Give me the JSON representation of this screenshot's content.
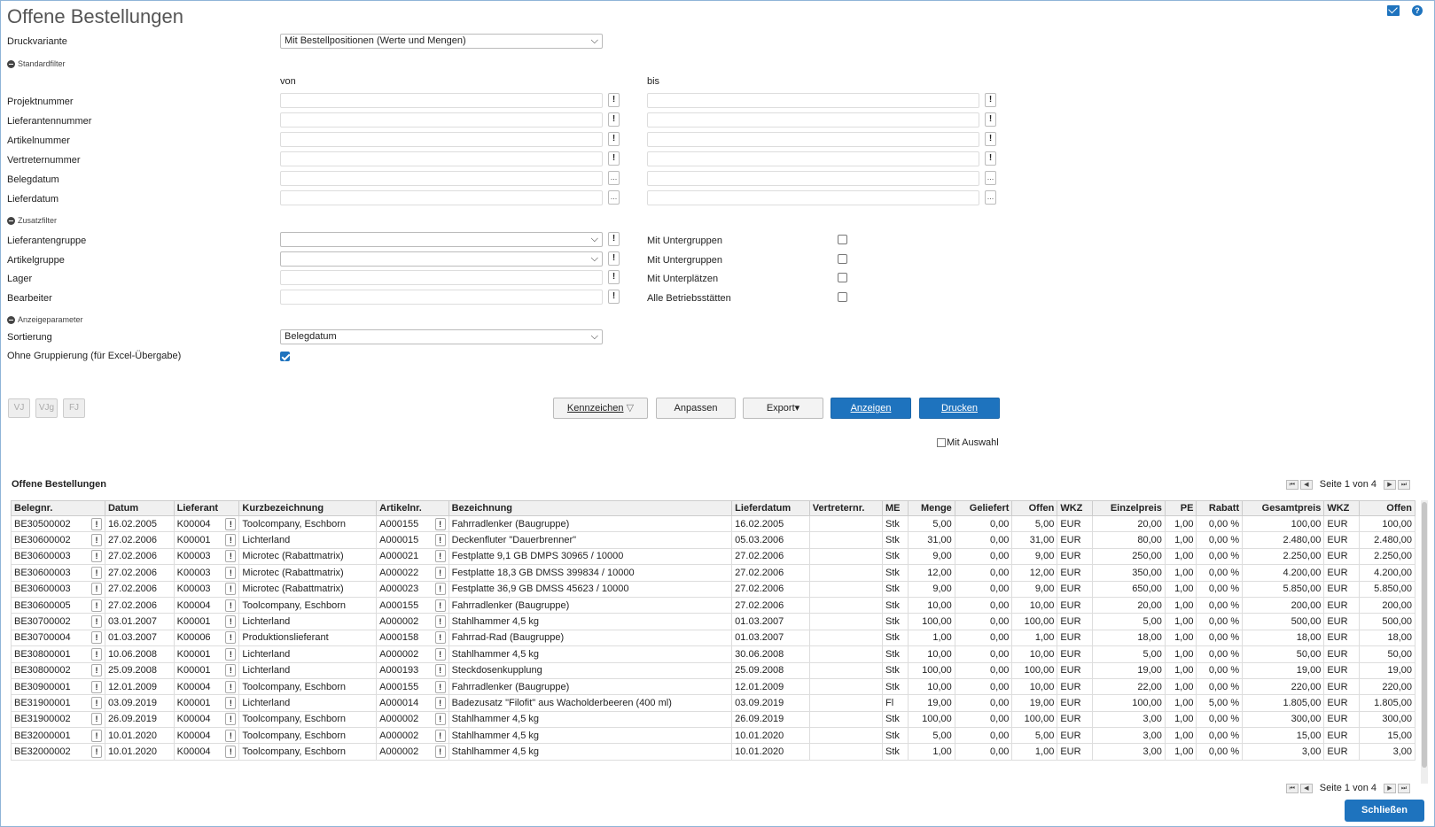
{
  "title": "Offene Bestellungen",
  "icons": {
    "mail": "mail-icon",
    "help": "help-icon"
  },
  "druckvariante": {
    "label": "Druckvariante",
    "value": "Mit Bestellpositionen (Werte und Mengen)"
  },
  "standardfilter": {
    "title": "Standardfilter",
    "von": "von",
    "bis": "bis",
    "rows": [
      "Projektnummer",
      "Lieferantennummer",
      "Artikelnummer",
      "Vertreternummer",
      "Belegdatum",
      "Lieferdatum"
    ]
  },
  "zusatzfilter": {
    "title": "Zusatzfilter",
    "rows": [
      {
        "label": "Lieferantengruppe",
        "right_label": "Mit Untergruppen"
      },
      {
        "label": "Artikelgruppe",
        "right_label": "Mit Untergruppen"
      },
      {
        "label": "Lager",
        "right_label": "Mit Unterplätzen"
      },
      {
        "label": "Bearbeiter",
        "right_label": "Alle Betriebsstätten"
      }
    ]
  },
  "anzeigeparameter": {
    "title": "Anzeigeparameter",
    "sortierung_label": "Sortierung",
    "sortierung_value": "Belegdatum",
    "gruppierung_label": "Ohne Gruppierung (für Excel-Übergabe)",
    "gruppierung_checked": true
  },
  "small_buttons": [
    "VJ",
    "VJg",
    "FJ"
  ],
  "buttons": {
    "kennzeichen": "Kennzeichen",
    "anpassen": "Anpassen",
    "export": "Export",
    "anzeigen": "Anzeigen",
    "drucken": "Drucken"
  },
  "mit_auswahl": "Mit Auswahl",
  "grid": {
    "title": "Offene Bestellungen",
    "pager": "Seite 1 von 4",
    "columns": [
      "Belegnr.",
      "Datum",
      "Lieferant",
      "Kurzbezeichnung",
      "Artikelnr.",
      "Bezeichnung",
      "Lieferdatum",
      "Vertreternr.",
      "ME",
      "Menge",
      "Geliefert",
      "Offen",
      "WKZ",
      "Einzelpreis",
      "PE",
      "Rabatt",
      "Gesamtpreis",
      "WKZ",
      "Offen"
    ],
    "rows": [
      [
        "BE30500002",
        "16.02.2005",
        "K00004",
        "Toolcompany, Eschborn",
        "A000155",
        "Fahrradlenker (Baugruppe)",
        "16.02.2005",
        "",
        "Stk",
        "5,00",
        "0,00",
        "5,00",
        "EUR",
        "20,00",
        "1,00",
        "0,00 %",
        "100,00",
        "EUR",
        "100,00"
      ],
      [
        "BE30600002",
        "27.02.2006",
        "K00001",
        "Lichterland",
        "A000015",
        "Deckenfluter \"Dauerbrenner\"",
        "05.03.2006",
        "",
        "Stk",
        "31,00",
        "0,00",
        "31,00",
        "EUR",
        "80,00",
        "1,00",
        "0,00 %",
        "2.480,00",
        "EUR",
        "2.480,00"
      ],
      [
        "BE30600003",
        "27.02.2006",
        "K00003",
        "Microtec (Rabattmatrix)",
        "A000021",
        "Festplatte 9,1 GB DMPS 30965 / 10000",
        "27.02.2006",
        "",
        "Stk",
        "9,00",
        "0,00",
        "9,00",
        "EUR",
        "250,00",
        "1,00",
        "0,00 %",
        "2.250,00",
        "EUR",
        "2.250,00"
      ],
      [
        "BE30600003",
        "27.02.2006",
        "K00003",
        "Microtec (Rabattmatrix)",
        "A000022",
        "Festplatte 18,3 GB DMSS 399834 / 10000",
        "27.02.2006",
        "",
        "Stk",
        "12,00",
        "0,00",
        "12,00",
        "EUR",
        "350,00",
        "1,00",
        "0,00 %",
        "4.200,00",
        "EUR",
        "4.200,00"
      ],
      [
        "BE30600003",
        "27.02.2006",
        "K00003",
        "Microtec (Rabattmatrix)",
        "A000023",
        "Festplatte 36,9 GB DMSS 45623 / 10000",
        "27.02.2006",
        "",
        "Stk",
        "9,00",
        "0,00",
        "9,00",
        "EUR",
        "650,00",
        "1,00",
        "0,00 %",
        "5.850,00",
        "EUR",
        "5.850,00"
      ],
      [
        "BE30600005",
        "27.02.2006",
        "K00004",
        "Toolcompany, Eschborn",
        "A000155",
        "Fahrradlenker (Baugruppe)",
        "27.02.2006",
        "",
        "Stk",
        "10,00",
        "0,00",
        "10,00",
        "EUR",
        "20,00",
        "1,00",
        "0,00 %",
        "200,00",
        "EUR",
        "200,00"
      ],
      [
        "BE30700002",
        "03.01.2007",
        "K00001",
        "Lichterland",
        "A000002",
        "Stahlhammer 4,5 kg",
        "01.03.2007",
        "",
        "Stk",
        "100,00",
        "0,00",
        "100,00",
        "EUR",
        "5,00",
        "1,00",
        "0,00 %",
        "500,00",
        "EUR",
        "500,00"
      ],
      [
        "BE30700004",
        "01.03.2007",
        "K00006",
        "Produktionslieferant",
        "A000158",
        "Fahrrad-Rad (Baugruppe)",
        "01.03.2007",
        "",
        "Stk",
        "1,00",
        "0,00",
        "1,00",
        "EUR",
        "18,00",
        "1,00",
        "0,00 %",
        "18,00",
        "EUR",
        "18,00"
      ],
      [
        "BE30800001",
        "10.06.2008",
        "K00001",
        "Lichterland",
        "A000002",
        "Stahlhammer 4,5 kg",
        "30.06.2008",
        "",
        "Stk",
        "10,00",
        "0,00",
        "10,00",
        "EUR",
        "5,00",
        "1,00",
        "0,00 %",
        "50,00",
        "EUR",
        "50,00"
      ],
      [
        "BE30800002",
        "25.09.2008",
        "K00001",
        "Lichterland",
        "A000193",
        "Steckdosenkupplung",
        "25.09.2008",
        "",
        "Stk",
        "100,00",
        "0,00",
        "100,00",
        "EUR",
        "19,00",
        "1,00",
        "0,00 %",
        "19,00",
        "EUR",
        "19,00"
      ],
      [
        "BE30900001",
        "12.01.2009",
        "K00004",
        "Toolcompany, Eschborn",
        "A000155",
        "Fahrradlenker (Baugruppe)",
        "12.01.2009",
        "",
        "Stk",
        "10,00",
        "0,00",
        "10,00",
        "EUR",
        "22,00",
        "1,00",
        "0,00 %",
        "220,00",
        "EUR",
        "220,00"
      ],
      [
        "BE31900001",
        "03.09.2019",
        "K00001",
        "Lichterland",
        "A000014",
        "Badezusatz \"Filofit\" aus Wacholderbeeren (400 ml)",
        "03.09.2019",
        "",
        "Fl",
        "19,00",
        "0,00",
        "19,00",
        "EUR",
        "100,00",
        "1,00",
        "5,00 %",
        "1.805,00",
        "EUR",
        "1.805,00"
      ],
      [
        "BE31900002",
        "26.09.2019",
        "K00004",
        "Toolcompany, Eschborn",
        "A000002",
        "Stahlhammer 4,5 kg",
        "26.09.2019",
        "",
        "Stk",
        "100,00",
        "0,00",
        "100,00",
        "EUR",
        "3,00",
        "1,00",
        "0,00 %",
        "300,00",
        "EUR",
        "300,00"
      ],
      [
        "BE32000001",
        "10.01.2020",
        "K00004",
        "Toolcompany, Eschborn",
        "A000002",
        "Stahlhammer 4,5 kg",
        "10.01.2020",
        "",
        "Stk",
        "5,00",
        "0,00",
        "5,00",
        "EUR",
        "3,00",
        "1,00",
        "0,00 %",
        "15,00",
        "EUR",
        "15,00"
      ],
      [
        "BE32000002",
        "10.01.2020",
        "K00004",
        "Toolcompany, Eschborn",
        "A000002",
        "Stahlhammer 4,5 kg",
        "10.01.2020",
        "",
        "Stk",
        "1,00",
        "0,00",
        "1,00",
        "EUR",
        "3,00",
        "1,00",
        "0,00 %",
        "3,00",
        "EUR",
        "3,00"
      ]
    ]
  },
  "close": "Schließen"
}
